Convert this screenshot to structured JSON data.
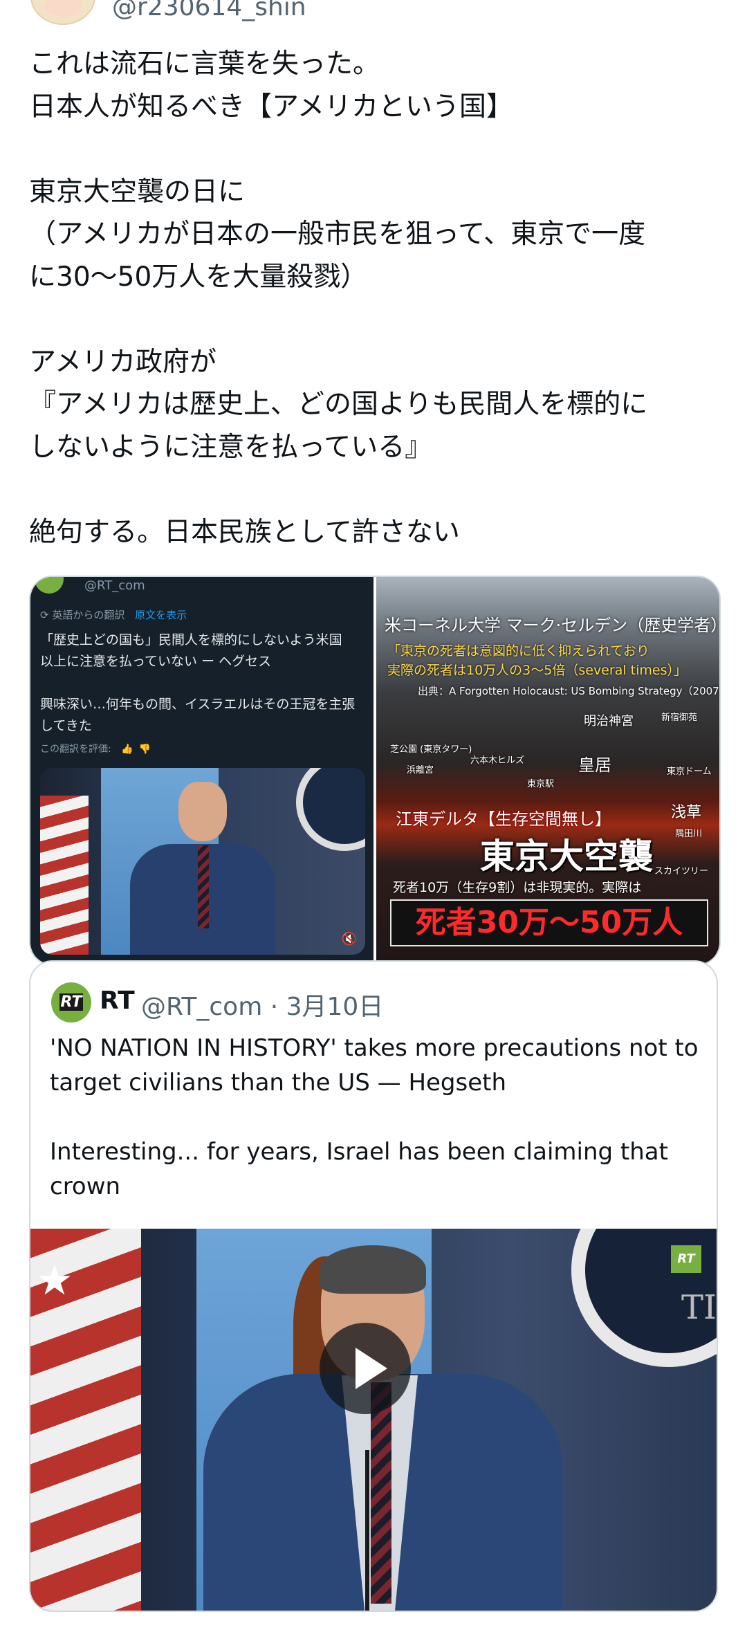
{
  "author": {
    "handle": "@r230614_shin"
  },
  "tweet": {
    "text": "これは流石に言葉を失った。\n日本人が知るべき【アメリカという国】\n\n東京大空襲の日に\n（アメリカが日本の一般市民を狙って、東京で一度\nに30〜50万人を大量殺戮）\n\nアメリカ政府が\n『アメリカは歴史上、どの国よりも民間人を標的に\nしないように注意を払っている』\n\n絶句する。日本民族として許さない"
  },
  "media_left": {
    "handle": "@RT_com",
    "translated_label": "英語からの翻訳",
    "show_original_link": "原文を表示",
    "text": "「歴史上どの国も」民間人を標的にしないよう米国\n以上に注意を払っていない ー ヘグセス\n\n興味深い…何年もの間、イスラエルはその王冠を主張\nしてきた",
    "rate_label": "この翻訳を評価:"
  },
  "media_right": {
    "title": "米コーネル大学 マーク·セルデン（歴史学者）",
    "quote_line1": "「東京の死者は意図的に低く抑えられており",
    "quote_line2": "実際の死者は10万人の3〜5倍（several times）」",
    "source": "出典：A Forgotten Holocaust: US Bombing Strategy（2007）",
    "locations": {
      "meiji": "明治神宮",
      "shinjuku": "新宿御苑",
      "shiba": "芝公園 (東京タワー)",
      "roppongi": "六本木ヒルズ",
      "hamarikyu": "浜離宮",
      "kokyo": "皇居",
      "dome": "東京ドーム",
      "tokyo_station": "東京駅",
      "asakusa": "浅草",
      "sumida": "隅田川",
      "skytree": "スカイツリー"
    },
    "koto_label": "江東デルタ【生存空間無し】",
    "raid_title": "東京大空襲",
    "dead_small": "死者10万（生存9割）は非現実的。実際は",
    "dead_big": "死者30万〜50万人"
  },
  "quote": {
    "logo": "RT",
    "name": "RT",
    "handle_date": "@RT_com · 3月10日",
    "text": "'NO NATION IN HISTORY' takes more precautions not to\ntarget civilians than the US — Hegseth\n\nInteresting... for years, Israel has been claiming that\ncrown",
    "video_corner_logo": "RT",
    "seal_text": "TI"
  }
}
